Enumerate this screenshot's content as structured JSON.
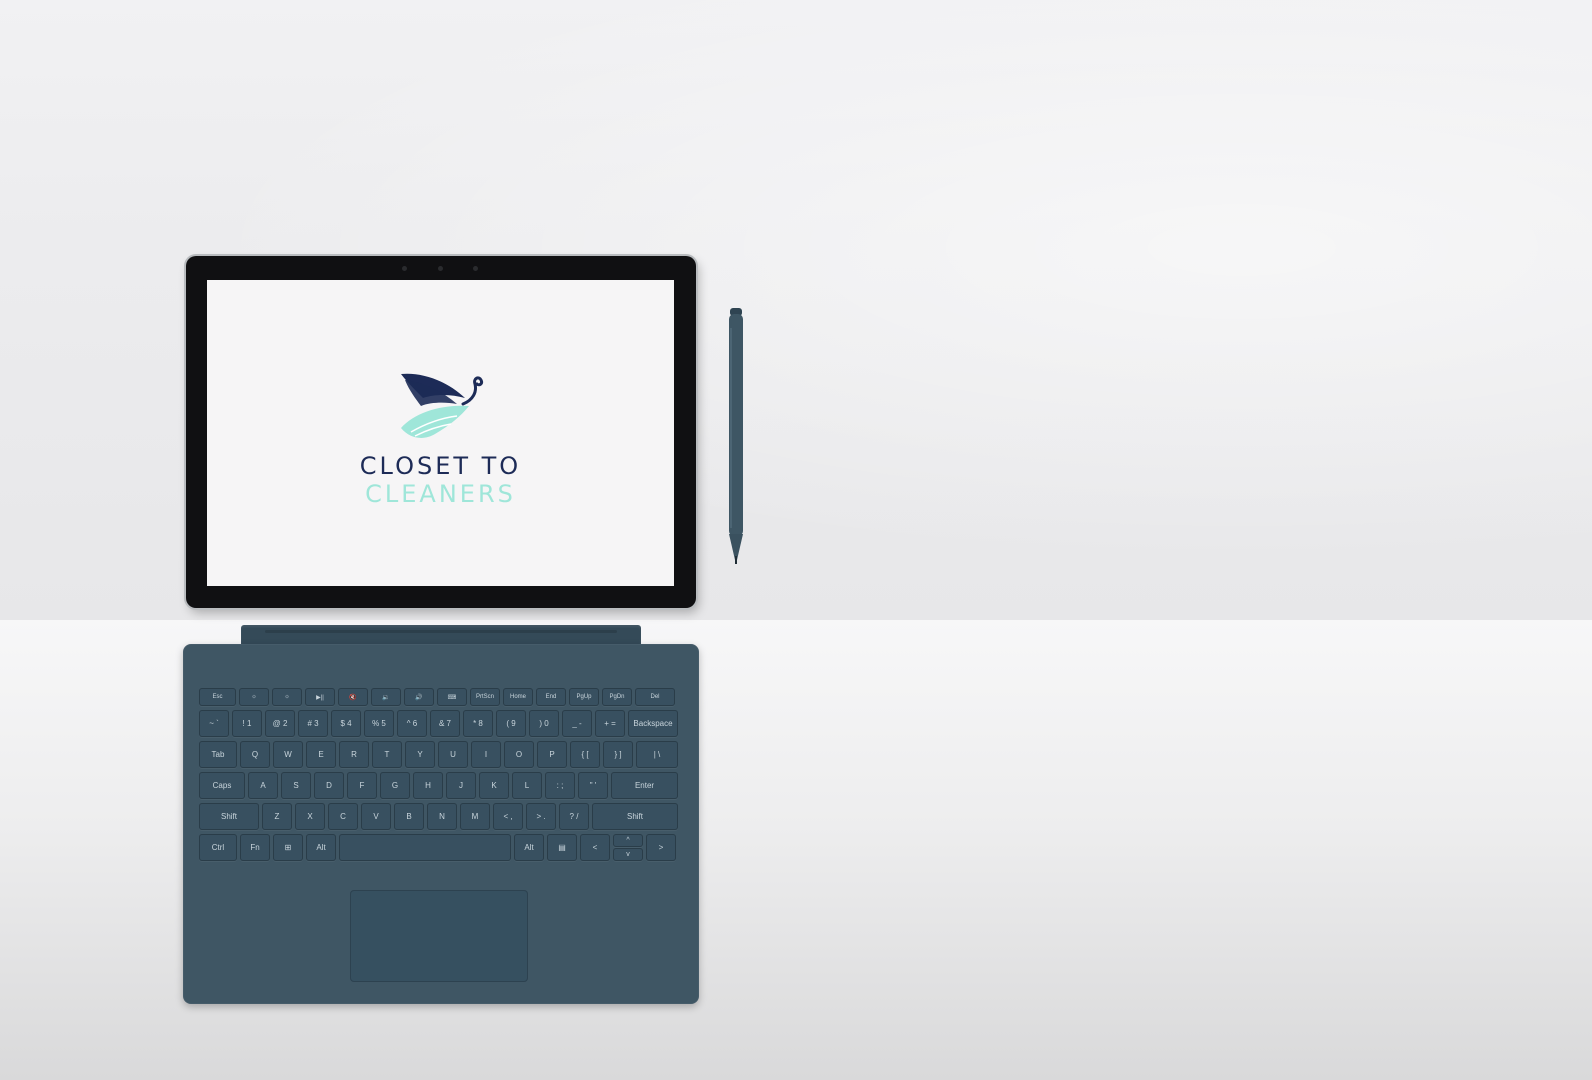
{
  "screen": {
    "brand_line1": "CLOSET TO",
    "brand_line2": "CLEANERS",
    "colors": {
      "navy": "#1d2b57",
      "mint": "#9fe6d9"
    }
  },
  "keyboard": {
    "fn_row": [
      "Esc",
      "☼",
      "☼",
      "▶||",
      "🔇",
      "🔉",
      "🔊",
      "⌨",
      "PrtScn",
      "Home",
      "End",
      "PgUp",
      "PgDn",
      "Del"
    ],
    "number_row": [
      "~ `",
      "! 1",
      "@ 2",
      "# 3",
      "$ 4",
      "% 5",
      "^ 6",
      "& 7",
      "* 8",
      "( 9",
      ") 0",
      "_ -",
      "+ =",
      "Backspace"
    ],
    "top_row": [
      "Tab",
      "Q",
      "W",
      "E",
      "R",
      "T",
      "Y",
      "U",
      "I",
      "O",
      "P",
      "{ [",
      "} ]",
      "| \\"
    ],
    "home_row": [
      "Caps",
      "A",
      "S",
      "D",
      "F",
      "G",
      "H",
      "J",
      "K",
      "L",
      ": ;",
      "\" '",
      "Enter"
    ],
    "bottom_row": [
      "Shift",
      "Z",
      "X",
      "C",
      "V",
      "B",
      "N",
      "M",
      "< ,",
      "> .",
      "? /",
      "Shift"
    ],
    "space_row": [
      "Ctrl",
      "Fn",
      "⊞",
      "Alt",
      "",
      "Alt",
      "▤",
      "<",
      "^",
      "v",
      ">"
    ]
  }
}
